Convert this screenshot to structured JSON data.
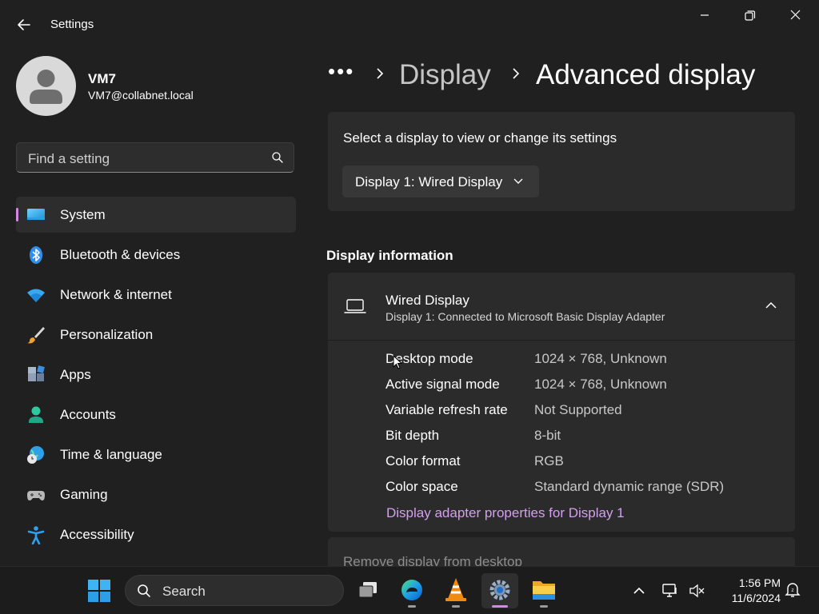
{
  "window": {
    "app_title": "Settings"
  },
  "account": {
    "name": "VM7",
    "email": "VM7@collabnet.local"
  },
  "search": {
    "placeholder": "Find a setting"
  },
  "sidebar": {
    "items": [
      {
        "label": "System",
        "icon": "system-monitor-icon",
        "active": true
      },
      {
        "label": "Bluetooth & devices",
        "icon": "bluetooth-icon"
      },
      {
        "label": "Network & internet",
        "icon": "wifi-icon"
      },
      {
        "label": "Personalization",
        "icon": "paintbrush-icon"
      },
      {
        "label": "Apps",
        "icon": "apps-grid-icon"
      },
      {
        "label": "Accounts",
        "icon": "account-person-icon"
      },
      {
        "label": "Time & language",
        "icon": "globe-clock-icon"
      },
      {
        "label": "Gaming",
        "icon": "gamepad-icon"
      },
      {
        "label": "Accessibility",
        "icon": "accessibility-person-icon"
      }
    ]
  },
  "breadcrumb": {
    "overflow": "•••",
    "parent": "Display",
    "current": "Advanced display"
  },
  "select_display": {
    "label": "Select a display to view or change its settings",
    "selected": "Display 1: Wired Display"
  },
  "display_info": {
    "section_title": "Display information",
    "title": "Wired Display",
    "subtitle": "Display 1: Connected to Microsoft Basic Display Adapter",
    "rows": [
      {
        "label": "Desktop mode",
        "value": "1024 × 768, Unknown"
      },
      {
        "label": "Active signal mode",
        "value": "1024 × 768, Unknown"
      },
      {
        "label": "Variable refresh rate",
        "value": "Not Supported"
      },
      {
        "label": "Bit depth",
        "value": "8-bit"
      },
      {
        "label": "Color format",
        "value": "RGB"
      },
      {
        "label": "Color space",
        "value": "Standard dynamic range (SDR)"
      }
    ],
    "adapter_link": "Display adapter properties for Display 1"
  },
  "remove_display": {
    "label": "Remove display from desktop"
  },
  "taskbar": {
    "search_label": "Search",
    "time": "1:56 PM",
    "date": "11/6/2024"
  },
  "colors": {
    "accent": "#d08ae3",
    "link": "#d59ff0",
    "background": "#202020",
    "card": "#2b2b2b"
  }
}
